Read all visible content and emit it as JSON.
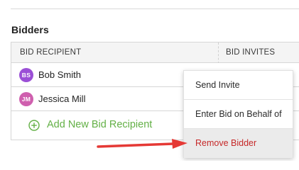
{
  "section": {
    "title": "Bidders"
  },
  "table": {
    "columns": [
      "BID RECIPIENT",
      "BID INVITES"
    ],
    "rows": [
      {
        "initials": "BS",
        "name": "Bob Smith"
      },
      {
        "initials": "JM",
        "name": "Jessica Mill"
      }
    ],
    "add_label": "Add New Bid Recipient"
  },
  "context_menu": {
    "items": [
      "Send Invite",
      "Enter Bid on Behalf of",
      "Remove Bidder"
    ],
    "highlighted_item": "Remove Bidder"
  },
  "colors": {
    "avatar_bs": "#9b4fd6",
    "avatar_jm": "#cf5fae",
    "add_green": "#63b046",
    "remove_red": "#c62828",
    "annotation_arrow": "#e53935"
  },
  "icons": {
    "add": "plus-circle-icon",
    "annotation": "red-arrow-icon"
  }
}
